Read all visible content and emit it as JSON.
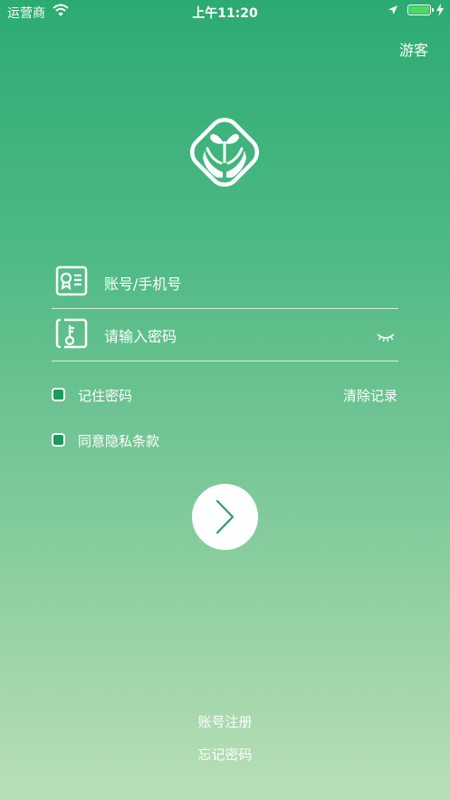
{
  "status_bar": {
    "carrier": "运营商",
    "time": "上午11:20",
    "battery_color": "#4cd964"
  },
  "header": {
    "guest_label": "游客"
  },
  "logo": {
    "icon": "sprout-hands-logo"
  },
  "form": {
    "account_placeholder": "账号/手机号",
    "account_icon": "id-card-icon",
    "password_placeholder": "请输入密码",
    "password_icon": "key-icon",
    "toggle_icon": "eye-closed-icon"
  },
  "options": {
    "remember_password": "记住密码",
    "clear_records": "清除记录",
    "agree_privacy": "同意隐私条款"
  },
  "login_button": {
    "icon": "chevron-right-icon"
  },
  "footer": {
    "register_label": "账号注册",
    "forgot_label": "忘记密码"
  },
  "colors": {
    "gradient_top": "#2bab72",
    "gradient_bottom": "#b9dfb7",
    "checkbox_fill": "#1e9b5c",
    "accent": "#2a9d68"
  }
}
